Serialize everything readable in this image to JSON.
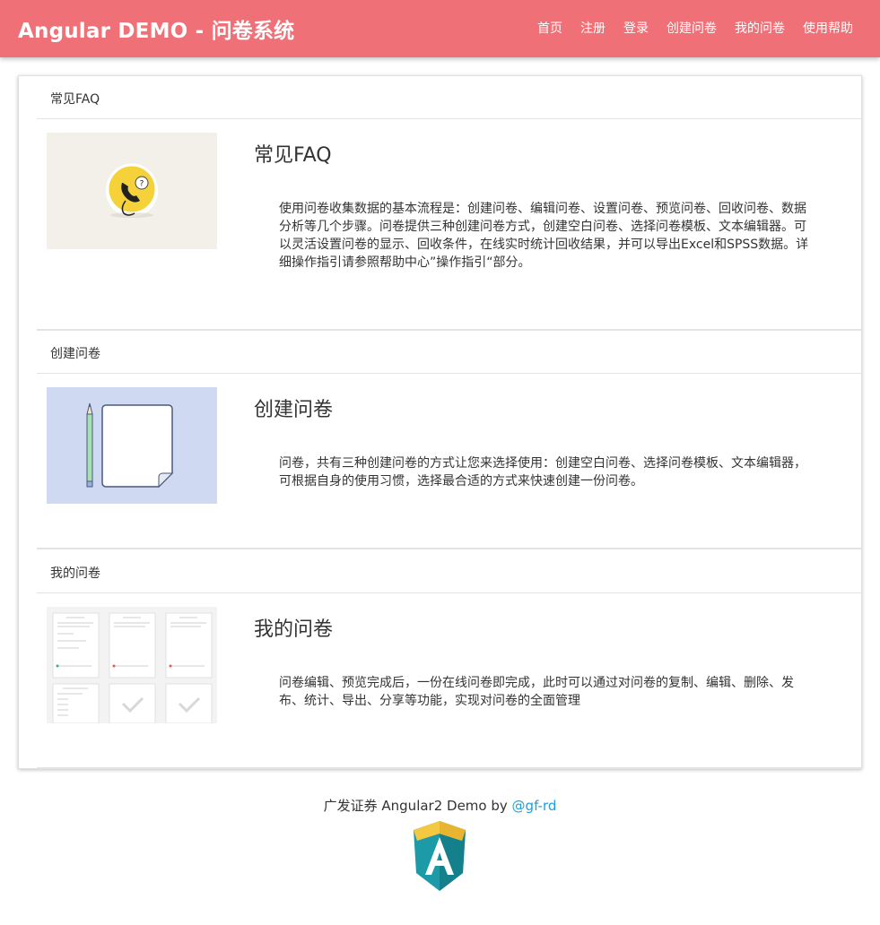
{
  "header": {
    "brand": "Angular DEMO - 问卷系统",
    "nav": [
      "首页",
      "注册",
      "登录",
      "创建问卷",
      "我的问卷",
      "使用帮助"
    ]
  },
  "sections": [
    {
      "heading": "常见FAQ",
      "title": "常见FAQ",
      "text": "使用问卷收集数据的基本流程是：创建问卷、编辑问卷、设置问卷、预览问卷、回收问卷、数据分析等几个步骤。问卷提供三种创建问卷方式，创建空白问卷、选择问卷模板、文本编辑器。可以灵活设置问卷的显示、回收条件，在线实时统计回收结果，并可以导出Excel和SPSS数据。详细操作指引请参照帮助中心”操作指引“部分。",
      "image_icon": "phone-help-icon"
    },
    {
      "heading": "创建问卷",
      "title": "创建问卷",
      "text": "问卷，共有三种创建问卷的方式让您来选择使用：创建空白问卷、选择问卷模板、文本编辑器，可根据自身的使用习惯，选择最合适的方式来快速创建一份问卷。",
      "image_icon": "pencil-paper-icon"
    },
    {
      "heading": "我的问卷",
      "title": "我的问卷",
      "text": "问卷编辑、预览完成后，一份在线问卷即完成，此时可以通过对问卷的复制、编辑、删除、发布、统计、导出、分享等功能，实现对问卷的全面管理",
      "image_icon": "survey-list-icon"
    }
  ],
  "footer": {
    "text": "广发证券 Angular2 Demo by",
    "link": "@gf-rd",
    "logo": "angular-logo-icon"
  },
  "colors": {
    "header_bg": "#f07077",
    "link": "#1a9fd9",
    "thumb1_bg": "#f2f0e8",
    "thumb2_bg": "#cfdaf2"
  }
}
